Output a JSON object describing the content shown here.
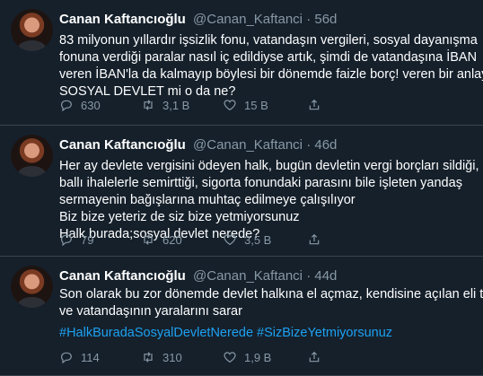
{
  "tweets": [
    {
      "name": "Canan Kaftancıoğlu",
      "handle": "@Canan_Kaftanci",
      "separator": "·",
      "time": "56d",
      "lines": [
        "83 milyonun yıllardır işsizlik  fonu, vatandaşın vergileri, sosyal dayanışma",
        "fonuna verdiği paralar nasıl iç edildiyse artık, şimdi de vatandaşına İBAN",
        "veren İBAN'la da kalmayıp böylesi bir dönemde faizle borç! veren bir  anlayış",
        "SOSYAL DEVLET mi o da ne?"
      ],
      "hashtags": "",
      "replies": "630",
      "retweets": "3,1 B",
      "likes": "15 B"
    },
    {
      "name": "Canan Kaftancıoğlu",
      "handle": "@Canan_Kaftanci",
      "separator": "·",
      "time": "46d",
      "lines": [
        "Her ay devlete vergisini ödeyen halk, bugün devletin vergi borçları sildiği,",
        "ballı ihalelerle semirttiği, sigorta fonundaki parasını bile işleten yandaş",
        "sermayenin bağışlarına muhtaç edilmeye çalışılıyor",
        "Biz bize yeteriz de siz bize yetmiyorsunuz",
        "Halk burada;sosyal devlet nerede?"
      ],
      "hashtags": "",
      "replies": "79",
      "retweets": "620",
      "likes": "3,5 B"
    },
    {
      "name": "Canan Kaftancıoğlu",
      "handle": "@Canan_Kaftanci",
      "separator": "·",
      "time": "44d",
      "lines": [
        "Son olarak bu zor dönemde devlet halkına el açmaz, kendisine açılan eli tutar",
        "ve vatandaşının yaralarını sarar"
      ],
      "hashtags": "#HalkBuradaSosyalDevletNerede #SizBizeYetmiyorsunuz",
      "replies": "114",
      "retweets": "310",
      "likes": "1,9 B"
    }
  ],
  "icons": [
    "avatar",
    "reply-icon",
    "retweet-icon",
    "like-icon",
    "share-icon"
  ],
  "colors": {
    "background": "#15202b",
    "divider": "#38444d",
    "secondary_text": "#8899a6",
    "hashtag": "#1da1f2"
  }
}
